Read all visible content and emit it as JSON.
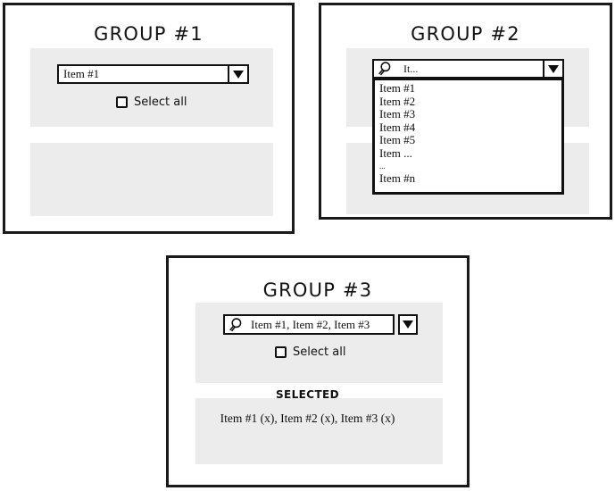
{
  "groups": [
    {
      "title": "GROUP #1",
      "combo": {
        "value": "Item #1",
        "arrow_icon": "chevron-down-icon"
      },
      "checkbox": {
        "label": "Select all",
        "checked": false
      }
    },
    {
      "title": "GROUP #2",
      "search": {
        "icon": "search-icon",
        "placeholder": "It...",
        "value": "",
        "arrow_icon": "chevron-down-icon"
      },
      "dropdown_items": [
        "Item #1",
        "Item #2",
        "Item #3",
        "Item #4",
        "Item #5",
        "Item ...",
        "...",
        "Item #n"
      ]
    },
    {
      "title": "GROUP #3",
      "search": {
        "icon": "search-icon",
        "value": "Item #1, Item #2, Item #3",
        "arrow_icon": "chevron-down-icon"
      },
      "checkbox": {
        "label": "Select all",
        "checked": false
      },
      "selected_panel": {
        "heading": "SELECTED",
        "items_text": "Item #1 (x), Item #2 (x), Item #3 (x)"
      }
    }
  ],
  "colors": {
    "panel_gray": "#ececec",
    "outline": "#111111",
    "page_background": "#ffffff"
  }
}
